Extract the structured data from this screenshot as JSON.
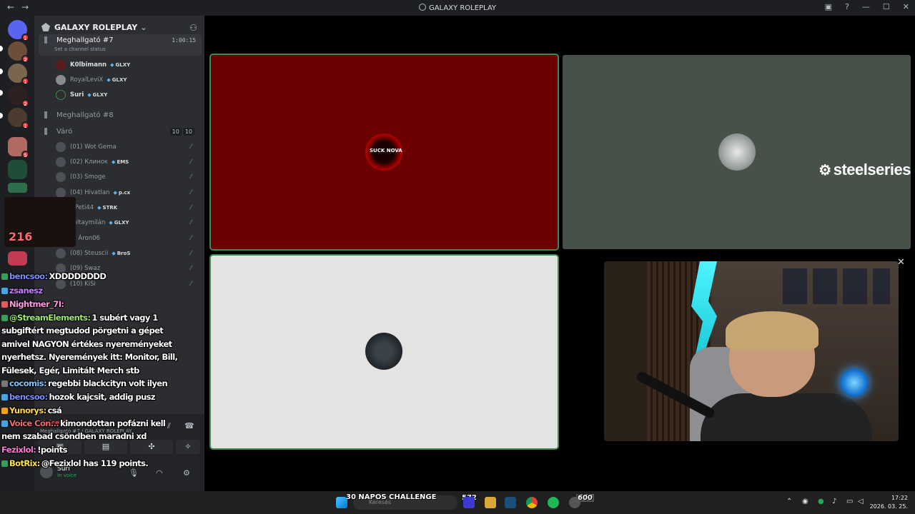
{
  "window": {
    "title": "GALAXY ROLEPLAY",
    "back": "←",
    "forward": "→"
  },
  "servers": [
    {
      "badge": ""
    },
    {
      "badge": "2"
    },
    {
      "badge": "1"
    },
    {
      "badge": "2"
    },
    {
      "badge": "1"
    },
    {
      "badge": "5"
    },
    {
      "badge": ""
    },
    {
      "badge": ""
    }
  ],
  "guild": {
    "name": "GALAXY ROLEPLAY"
  },
  "channels": {
    "active": {
      "name": "Meghallgató #7",
      "timer": "1:00:15",
      "status": "Set a channel status"
    },
    "active_users": [
      {
        "name": "K0lbimann",
        "tag": "GLXY"
      },
      {
        "name": "RoyalLeviX",
        "tag": "GLXY"
      },
      {
        "name": "Suri",
        "tag": "GLXY"
      }
    ],
    "meghallgato8": "Meghallgató #8",
    "varo": {
      "name": "Váró",
      "count_a": "10",
      "count_b": "10"
    },
    "waiting": [
      {
        "name": "(01) Wot Gema",
        "tag": ""
      },
      {
        "name": "(02) Клинок",
        "tag": "EMS"
      },
      {
        "name": "(03) Smoge",
        "tag": ""
      },
      {
        "name": "(04) Hivatlan",
        "tag": "p.cx"
      },
      {
        "name": "GPeti44",
        "tag": "STRK"
      },
      {
        "name": "koltaymilán",
        "tag": "GLXY"
      },
      {
        "name": "7) Áron06",
        "tag": ""
      },
      {
        "name": "(08) Steuscii",
        "tag": "BroS"
      },
      {
        "name": "(09) Swaz",
        "tag": ""
      },
      {
        "name": "(10) KiSi",
        "tag": ""
      }
    ]
  },
  "voice_panel": {
    "state": "Voice Connected",
    "location": "Meghallgató #7 / GALAXY ROLEPLAY",
    "user": "Suri",
    "user_status": "In voice"
  },
  "chat": [
    {
      "user": "bencsoo:",
      "color": "#7b8cff",
      "text": "XDDDDDDDD"
    },
    {
      "user": "zsanesz",
      "color": "#c77dff",
      "text": ""
    },
    {
      "user": "Nightmer_7I:",
      "color": "#ff9ae0",
      "text": ""
    },
    {
      "user": "@StreamElements:",
      "color": "#9fe870",
      "text": "1 subért vagy 1"
    },
    {
      "user": "",
      "color": "#fff",
      "text": "subgiftért megtudod pörgetni a gépet"
    },
    {
      "user": "",
      "color": "#fff",
      "text": "amivel NAGYON értékes nyereményeket"
    },
    {
      "user": "",
      "color": "#fff",
      "text": "nyerhetsz. Nyeremények itt: Monitor, Bill,"
    },
    {
      "user": "",
      "color": "#fff",
      "text": "Fülesek, Egér, Limitált Merch stb"
    },
    {
      "user": "cocomis:",
      "color": "#7bc6ff",
      "text": "regebbi blackcityn volt ilyen"
    },
    {
      "user": "bencsoo:",
      "color": "#7b8cff",
      "text": "hozok kajcsit, addig pusz"
    },
    {
      "user": "Yunorys:",
      "color": "#ffd84d",
      "text": "csá"
    },
    {
      "user": "Voice Con...",
      "color": "#f06b6b",
      "text": "kimondottan pofázni kell"
    },
    {
      "user": "",
      "color": "#fff",
      "text": "nem szabad csöndben maradni xd"
    },
    {
      "user": "Fezixlol:",
      "color": "#ff7ad9",
      "text": "!points"
    },
    {
      "user": "BotRix:",
      "color": "#ffe14d",
      "text": "@Fezixlol has 119 points."
    }
  ],
  "overlay": {
    "counter": "216"
  },
  "tiles": {
    "t1": {
      "label": "SUCK NOVA"
    },
    "t2": {
      "brand": "steelseries"
    }
  },
  "taskbar": {
    "challenge": "30 NAPOS CHALLENGE",
    "search_placeholder": "Keresés",
    "count1": "572",
    "count2": "600",
    "time": "17:22",
    "date": "2026. 03. 25."
  },
  "colors": {
    "accent": "#5865f2",
    "danger": "#f23f43",
    "speaking": "#3e8a55",
    "tile_red": "#6b0000",
    "tile_green": "#46514a",
    "tile_light": "#e3e3e2"
  }
}
